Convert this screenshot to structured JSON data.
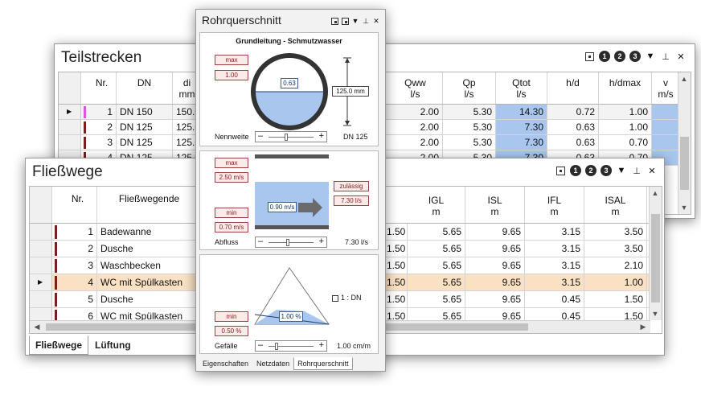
{
  "teilstrecken": {
    "title": "Teilstrecken",
    "controls": [
      "1",
      "2",
      "3"
    ],
    "headers": [
      {
        "top": "Nr.",
        "bottom": ""
      },
      {
        "top": "DN",
        "bottom": ""
      },
      {
        "top": "di",
        "bottom": "mm"
      },
      {
        "top": "Qww",
        "bottom": "l/s"
      },
      {
        "top": "Qp",
        "bottom": "l/s"
      },
      {
        "top": "Qtot",
        "bottom": "l/s"
      },
      {
        "top": "h/d",
        "bottom": ""
      },
      {
        "top": "h/dmax",
        "bottom": ""
      },
      {
        "top": "v",
        "bottom": "m/s"
      }
    ],
    "rows": [
      {
        "nr": "1",
        "dn": "DN 150",
        "di": "150.0",
        "qww": "2.00",
        "qp": "5.30",
        "qtot": "14.30",
        "hd": "0.72",
        "hdmax": "1.00",
        "marker": "#e055e0"
      },
      {
        "nr": "2",
        "dn": "DN 125",
        "di": "125.0",
        "qww": "2.00",
        "qp": "5.30",
        "qtot": "7.30",
        "hd": "0.63",
        "hdmax": "1.00",
        "marker": "#7a1f1f"
      },
      {
        "nr": "3",
        "dn": "DN 125",
        "di": "125.0",
        "qww": "2.00",
        "qp": "5.30",
        "qtot": "7.30",
        "hd": "0.63",
        "hdmax": "0.70",
        "marker": "#7a1f1f"
      },
      {
        "nr": "4",
        "dn": "DN 125",
        "di": "125.0",
        "qww": "2.00",
        "qp": "5.30",
        "qtot": "7.30",
        "hd": "0.63",
        "hdmax": "0.70",
        "marker": "#7a1f1f"
      }
    ]
  },
  "fliesswege": {
    "title": "Fließwege",
    "controls": [
      "1",
      "2",
      "3"
    ],
    "headers": [
      {
        "top": "Nr.",
        "bottom": ""
      },
      {
        "top": "Fließwegende",
        "bottom": ""
      },
      {
        "top": "IGL",
        "bottom": "m"
      },
      {
        "top": "ISL",
        "bottom": "m"
      },
      {
        "top": "IFL",
        "bottom": "m"
      },
      {
        "top": "ISAL",
        "bottom": "m"
      }
    ],
    "rows": [
      {
        "nr": "1",
        "name": "Badewanne",
        "c0": "1.50",
        "igl": "5.65",
        "isl": "9.65",
        "ifl": "3.15",
        "isal": "3.50"
      },
      {
        "nr": "2",
        "name": "Dusche",
        "c0": "1.50",
        "igl": "5.65",
        "isl": "9.65",
        "ifl": "3.15",
        "isal": "3.50"
      },
      {
        "nr": "3",
        "name": "Waschbecken",
        "c0": "1.50",
        "igl": "5.65",
        "isl": "9.65",
        "ifl": "3.15",
        "isal": "2.10"
      },
      {
        "nr": "4",
        "name": "WC mit Spülkasten",
        "c0": "1.50",
        "igl": "5.65",
        "isl": "9.65",
        "ifl": "3.15",
        "isal": "1.00"
      },
      {
        "nr": "5",
        "name": "Dusche",
        "c0": "1.50",
        "igl": "5.65",
        "isl": "9.65",
        "ifl": "0.45",
        "isal": "1.50"
      },
      {
        "nr": "6",
        "name": "WC mit Spülkasten",
        "c0": "1.50",
        "igl": "5.65",
        "isl": "9.65",
        "ifl": "0.45",
        "isal": "1.50"
      }
    ],
    "tabs": [
      "Fließwege",
      "Lüftung"
    ]
  },
  "rohrquerschnitt": {
    "title": "Rohrquerschnitt",
    "subtitle": "Grundleitung - Schmutzwasser",
    "panel1": {
      "max_label": "max",
      "max_value": "1.00",
      "fill_value": "0.63",
      "dim_value": "125.0 mm",
      "slider_label": "Nennweite",
      "slider_value": "DN 125"
    },
    "panel2": {
      "max_label": "max",
      "max_value": "2.50 m/s",
      "min_label": "min",
      "min_value": "0.70 m/s",
      "speed_value": "0.90 m/s",
      "allowed_label": "zulässig",
      "allowed_value": "7.30 l/s",
      "slider_label": "Abfluss",
      "slider_value": "7.30 l/s"
    },
    "panel3": {
      "min_label": "min",
      "min_value": "0.50 %",
      "slope_value": "1.00 %",
      "checkbox_label": "1 : DN",
      "slider_label": "Gefälle",
      "slider_value": "1.00 cm/m"
    },
    "tabs": [
      "Eigenschaften",
      "Netzdaten",
      "Rohrquerschnitt"
    ]
  },
  "colors": {
    "accent": "#a9c7ee",
    "selected_row": "#fbe1c4",
    "marker": "#7a1f1f",
    "label_red": "#8a1c1c"
  }
}
